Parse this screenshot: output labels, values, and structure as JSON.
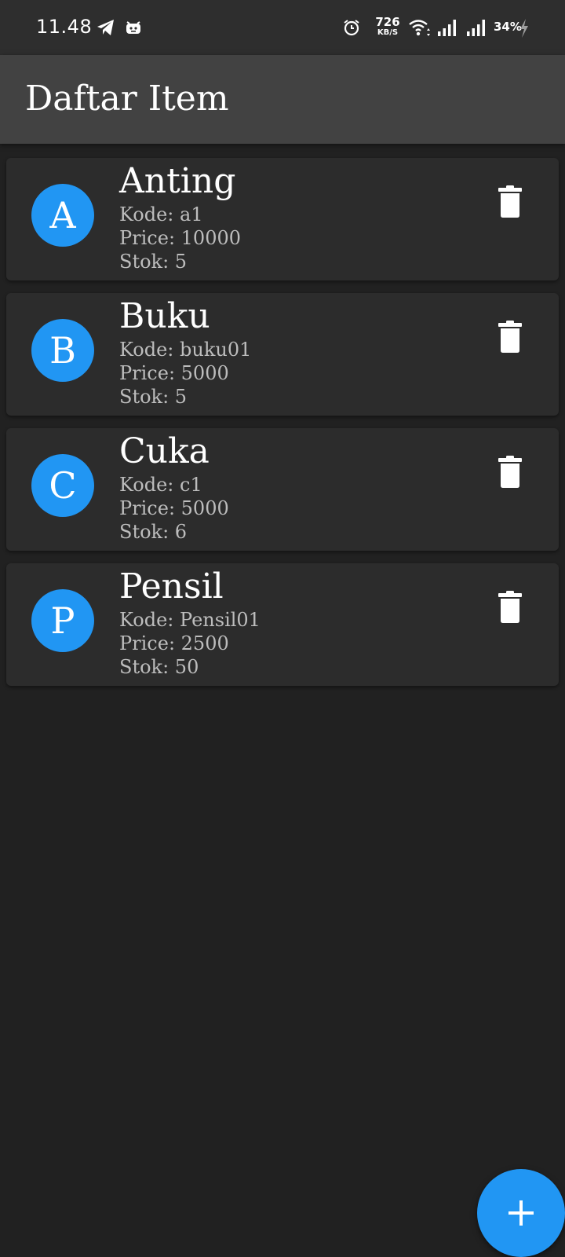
{
  "status_bar": {
    "time": "11.48",
    "net_speed": "726",
    "net_unit": "KB/S",
    "battery": "34%",
    "icons": [
      "telegram-icon",
      "notification-app-icon",
      "alarm-icon",
      "wifi-icon",
      "signal-icon",
      "signal-icon",
      "charging-icon"
    ]
  },
  "app_bar": {
    "title": "Daftar Item"
  },
  "items": [
    {
      "initial": "A",
      "name": "Anting",
      "kode": "Kode: a1",
      "price": "Price: 10000",
      "stok": "Stok: 5"
    },
    {
      "initial": "B",
      "name": "Buku",
      "kode": "Kode: buku01",
      "price": "Price: 5000",
      "stok": "Stok: 5"
    },
    {
      "initial": "C",
      "name": "Cuka",
      "kode": "Kode: c1",
      "price": "Price: 5000",
      "stok": "Stok: 6"
    },
    {
      "initial": "P",
      "name": "Pensil",
      "kode": "Kode: Pensil01",
      "price": "Price: 2500",
      "stok": "Stok: 50"
    }
  ],
  "fab": {
    "icon": "plus-icon"
  },
  "colors": {
    "accent": "#2196f3",
    "background": "#212121",
    "app_bar": "#424242",
    "card": "#2c2c2c"
  }
}
